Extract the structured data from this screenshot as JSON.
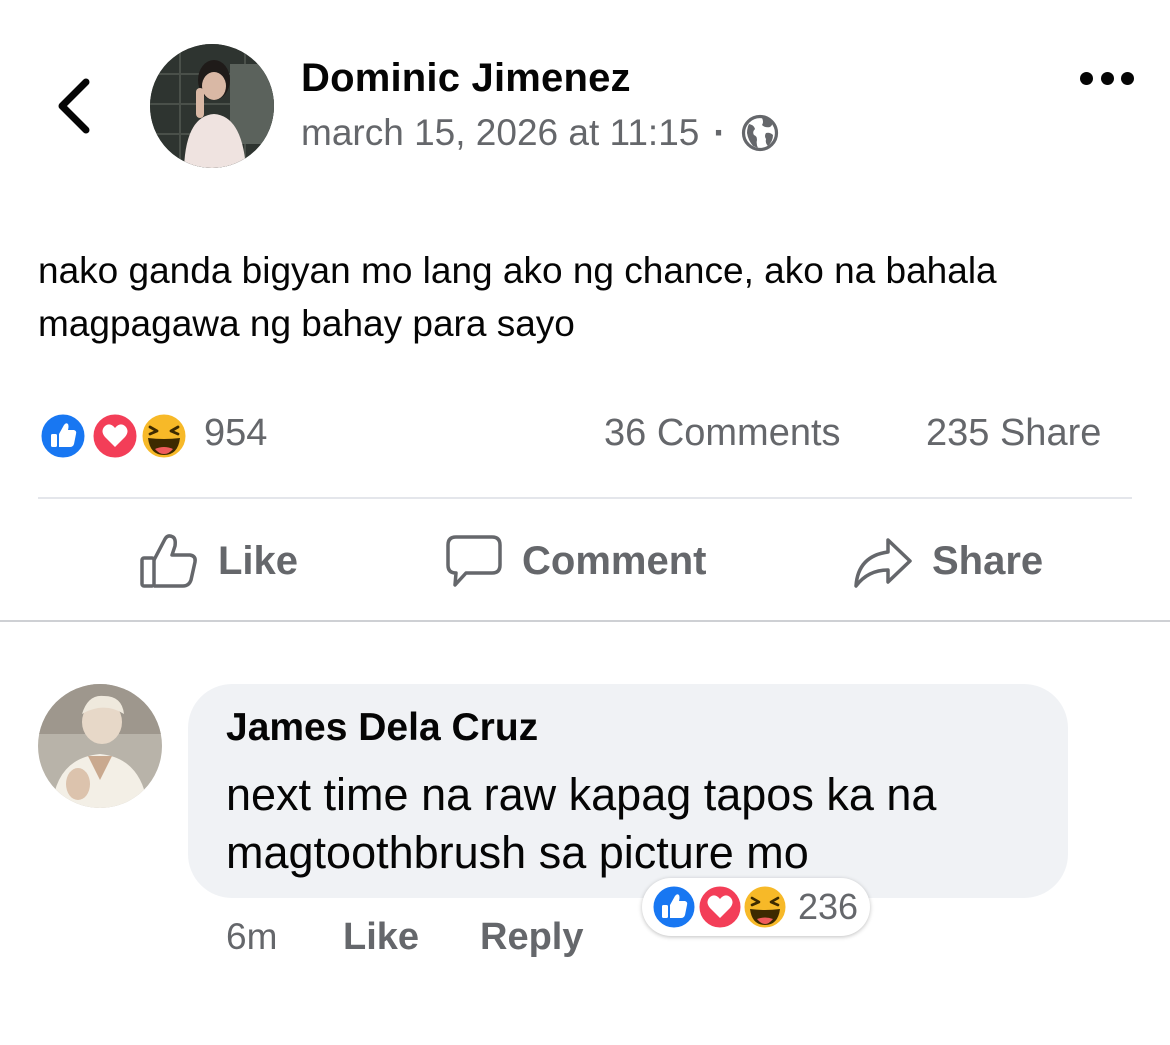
{
  "post": {
    "author": "Dominic Jimenez",
    "timestamp": "march 15, 2026 at 11:15",
    "separator": "·",
    "privacy_icon": "globe-icon",
    "text": "nako ganda bigyan mo lang ako ng chance, ako na bahala magpagawa ng bahay para sayo",
    "reaction_icons": [
      "like-reaction-icon",
      "love-reaction-icon",
      "haha-reaction-icon"
    ],
    "reaction_count": "954",
    "comments_count": "36 Comments",
    "shares_count": "235 Share"
  },
  "actions": {
    "like_label": "Like",
    "comment_label": "Comment",
    "share_label": "Share"
  },
  "comment": {
    "author": "James Dela Cruz",
    "text": "next time na raw kapag tapos ka na magtoothbrush sa picture mo",
    "reaction_count": "236",
    "time": "6m",
    "like_label": "Like",
    "reply_label": "Reply"
  },
  "colors": {
    "facebook_blue": "#1877f2",
    "love_red": "#f33e58",
    "haha_yellow": "#f7b928",
    "secondary_text": "#65676b",
    "bubble_bg": "#f0f2f5"
  }
}
